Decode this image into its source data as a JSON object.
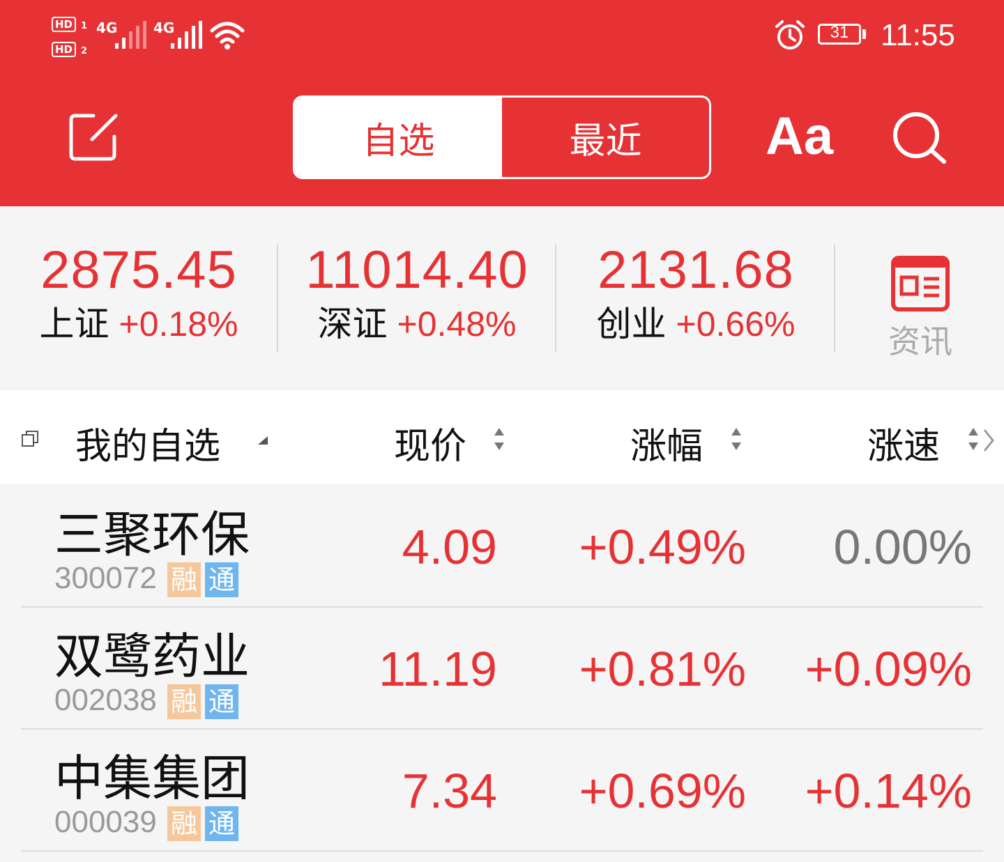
{
  "status_bar": {
    "sim1": "HD",
    "sim1_num": "1",
    "sim2": "HD",
    "sim2_num": "2",
    "net1": "4G",
    "net2": "4G",
    "battery_level": "31",
    "time": "11:55"
  },
  "header": {
    "tab_watchlist": "自选",
    "tab_recent": "最近",
    "font_size_label": "Aa",
    "active_tab": "自选"
  },
  "indices": [
    {
      "value": "2875.45",
      "name": "上证",
      "change": "+0.18%"
    },
    {
      "value": "11014.40",
      "name": "深证",
      "change": "+0.48%"
    },
    {
      "value": "2131.68",
      "name": "创业",
      "change": "+0.66%"
    }
  ],
  "news_label": "资讯",
  "columns": {
    "name": "我的自选",
    "price": "现价",
    "change": "涨幅",
    "speed": "涨速"
  },
  "stocks": [
    {
      "name": "三聚环保",
      "code": "300072",
      "tag1": "融",
      "tag2": "通",
      "price": "4.09",
      "change": "+0.49%",
      "speed": "0.00%"
    },
    {
      "name": "双鹭药业",
      "code": "002038",
      "tag1": "融",
      "tag2": "通",
      "price": "11.19",
      "change": "+0.81%",
      "speed": "+0.09%"
    },
    {
      "name": "中集集团",
      "code": "000039",
      "tag1": "融",
      "tag2": "通",
      "price": "7.34",
      "change": "+0.69%",
      "speed": "+0.14%"
    }
  ],
  "colors": {
    "brand_red": "#e63234",
    "rise": "#e63234",
    "flat": "#777777",
    "tag_rong": "#f6c79a",
    "tag_tong": "#6fb5ee"
  }
}
